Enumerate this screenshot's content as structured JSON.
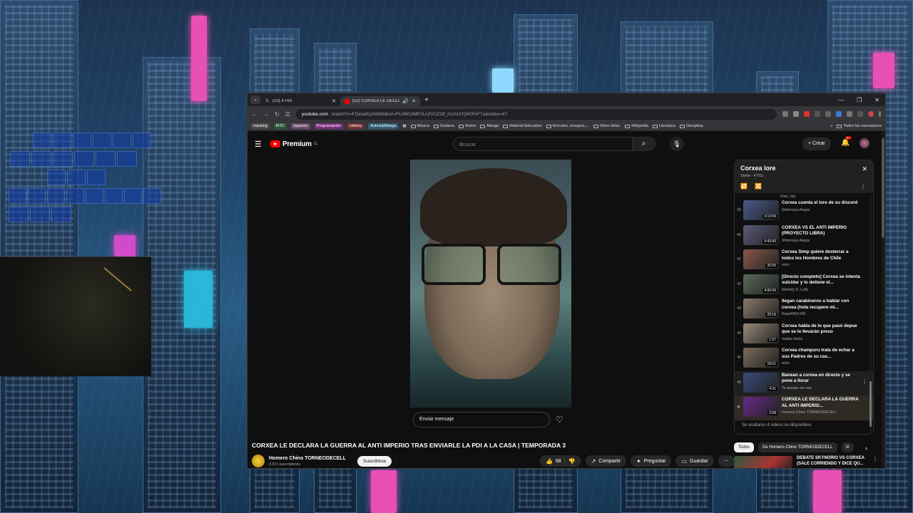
{
  "browser": {
    "tabs": [
      {
        "label": "(13) X Pro",
        "icon": "x-logo-icon",
        "active": false
      },
      {
        "label": "(52) CORXEA LE DECLARA L",
        "icon": "youtube-icon",
        "active": true
      }
    ],
    "new_tab": "+",
    "url_host": "youtube.com",
    "url_path": "/watch?v=FDeoaEpXWb8&list=PL06KztMPJLnZVUZ1ff_m2AIXYjM2PvF7a&index=47",
    "bookmarks_chips": [
      {
        "label": "Hacking",
        "color": "#4a4a4a"
      },
      {
        "label": "MTC",
        "color": "#2d5a3a"
      },
      {
        "label": "Japones",
        "color": "#6a4a6a"
      },
      {
        "label": "Programación",
        "color": "#7a2f7a"
      },
      {
        "label": "Udemy",
        "color": "#7a2f2f"
      },
      {
        "label": "Anime&Manga",
        "color": "#2f5e7a"
      }
    ],
    "bookmark_folders": [
      "Música",
      "Guitarra",
      "Animé",
      "Manga",
      "Material Educativo",
      "Artículos, ensayos,...",
      "Sitios útiles.",
      "Wikipedia",
      "Literatura",
      "Disciplina"
    ],
    "all_bookmarks": "Todos los marcadores"
  },
  "youtube": {
    "logo_text": "Premium",
    "logo_region": "CL",
    "search_placeholder": "Buscar",
    "create_label": "Crear",
    "notif_count": "9+",
    "message_placeholder": "Enviar mensaje",
    "video_title": "CORXEA LE DECLARA LA GUERRA AL ANTI IMPERIO TRAS ENVIARLE LA PDI A LA CASA | TEMPORADA 3",
    "channel_name": "Homero Chino TORNEODECELL",
    "channel_subs": "3.8 K suscriptores",
    "subscribe_label": "Suscribirse",
    "likes": "68",
    "share_label": "Compartir",
    "ask_label": "Preguntar",
    "save_label": "Guardar"
  },
  "playlist": {
    "title": "Corxea lore",
    "subtitle": "Stelle - 47/51",
    "prev_channel": "Dark_Sky",
    "items": [
      {
        "index": "39",
        "title": "Corxea cuenta el lore de su discord",
        "channel": "Shirimoya Alegre",
        "duration": "3:13:56",
        "thumb": "#4a5a8a"
      },
      {
        "index": "40",
        "title": "CORXEA VS EL ANTI IMPERIO (PROYECTO LIBRA)",
        "channel": "Shirimoya Alegre",
        "duration": "4:43:56",
        "thumb": "#5a5a7a"
      },
      {
        "index": "41",
        "title": "Corxea Simp quiere desterrar a todos los Hombres de Chile",
        "channel": "retro",
        "duration": "26:55",
        "thumb": "#8a5a4a"
      },
      {
        "index": "42",
        "title": "[Directo completo] Corxea se intenta suicidar y lo detiene el...",
        "channel": "Monkdy D. Luffy",
        "duration": "4:00:09",
        "thumb": "#5a6a5a"
      },
      {
        "index": "43",
        "title": "llegan carabineros a hablar con corxea (hola recupere mi...",
        "channel": "RasuRIFA DM",
        "duration": "29:16",
        "thumb": "#8a7a6a"
      },
      {
        "index": "44",
        "title": "Corxea habla de lo que pasó depue que se lo llevarán preso",
        "channel": "matias beiza",
        "duration": "1:57",
        "thumb": "#9a8a7a"
      },
      {
        "index": "45",
        "title": "Corxea champuru trata de echar a sus Padres de su cas...",
        "channel": "retro",
        "duration": "18:01",
        "thumb": "#7a6a5a"
      },
      {
        "index": "46",
        "title": "Banean a corxea en directo y se pone a llorar",
        "channel": "Te quedas sin eso",
        "duration": "4:31",
        "thumb": "#3a4a7a"
      },
      {
        "index": "▶",
        "title": "CORXEA LE DECLARA LA GUERRA AL ANTI IMPERIO...",
        "channel": "Homero Chino TORNEODECELL",
        "duration": "3:58",
        "thumb": "#6a2a8a"
      }
    ],
    "hidden_note": "Se ocultaron 4 videos no disponibles"
  },
  "filters": [
    "Todos",
    "De Homero Chino TORNEODECELL",
    "Vi"
  ],
  "recommended": {
    "title": "DEBATE SKYNORIO VS CORXEA (SALE CORRIENDO Y DICE QU..."
  }
}
